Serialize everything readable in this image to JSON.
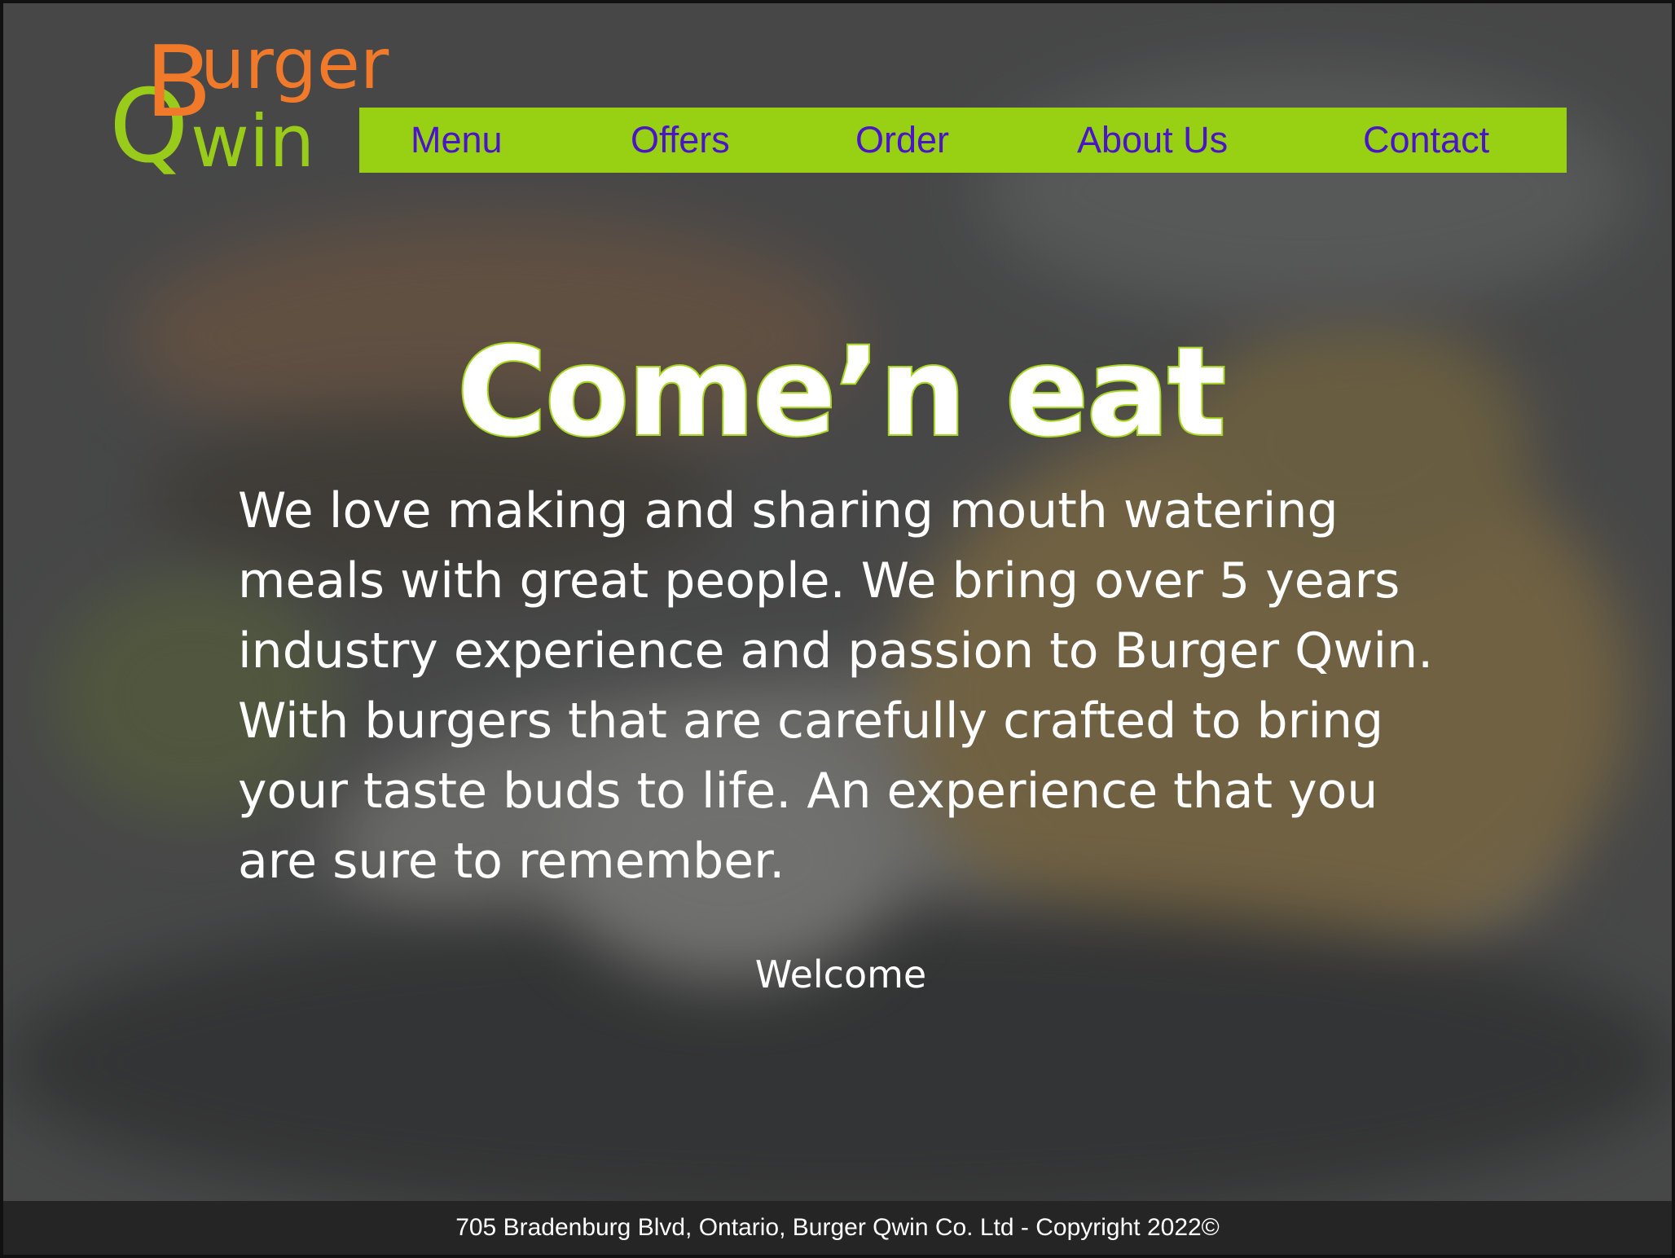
{
  "logo": {
    "big_b": "B",
    "burger_rest": "urger",
    "big_q": "Q",
    "qwin_rest": "win",
    "colors": {
      "burger": "#f07a2a",
      "qwin": "#99cc1a"
    }
  },
  "nav": {
    "background": "#98d014",
    "text_color": "#4a14c8",
    "items": [
      {
        "label": "Menu"
      },
      {
        "label": "Offers"
      },
      {
        "label": "Order"
      },
      {
        "label": "About Us"
      },
      {
        "label": "Contact"
      }
    ]
  },
  "hero": {
    "headline": "Come’n eat",
    "intro": "We love making and sharing mouth watering meals with great people. We bring over 5 years industry experience and passion to Burger Qwin. With burgers that are carefully crafted to bring your taste buds to life. An experience that you are sure to remember.",
    "welcome": "Welcome"
  },
  "footer": {
    "text": "705 Bradenburg Blvd, Ontario, Burger Qwin Co. Ltd - Copyright 2022©"
  }
}
